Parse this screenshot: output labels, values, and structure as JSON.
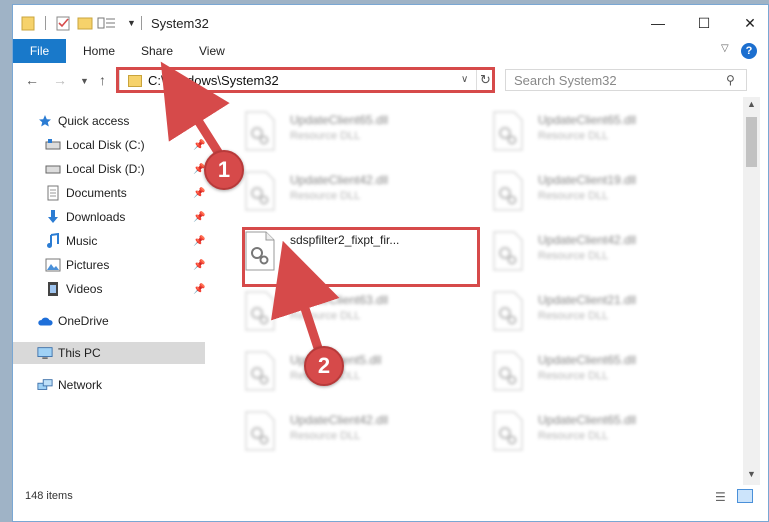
{
  "window": {
    "title": "System32",
    "controls": {
      "minimize": "—",
      "maximize": "☐",
      "close": "✕"
    }
  },
  "ribbon": {
    "tabs": [
      {
        "label": "File"
      },
      {
        "label": "Home"
      },
      {
        "label": "Share"
      },
      {
        "label": "View"
      }
    ],
    "help": "?"
  },
  "address": {
    "path": "C:\\Windows\\System32",
    "search_placeholder": "Search System32"
  },
  "sidebar": {
    "items": [
      {
        "label": "Quick access",
        "icon": "star-icon",
        "pinned": false
      },
      {
        "label": "Local Disk (C:)",
        "icon": "drive-icon",
        "pinned": true
      },
      {
        "label": "Local Disk (D:)",
        "icon": "drive-icon",
        "pinned": true
      },
      {
        "label": "Documents",
        "icon": "documents-icon",
        "pinned": true
      },
      {
        "label": "Downloads",
        "icon": "download-icon",
        "pinned": true
      },
      {
        "label": "Music",
        "icon": "music-icon",
        "pinned": true
      },
      {
        "label": "Pictures",
        "icon": "pictures-icon",
        "pinned": true
      },
      {
        "label": "Videos",
        "icon": "video-icon",
        "pinned": true
      },
      {
        "label": "OneDrive",
        "icon": "cloud-icon",
        "pinned": false
      },
      {
        "label": "This PC",
        "icon": "computer-icon",
        "pinned": false
      },
      {
        "label": "Network",
        "icon": "network-icon",
        "pinned": false
      }
    ]
  },
  "files": {
    "left": [
      {
        "name": "UpdateClient65.dll",
        "type": "Resource DLL"
      },
      {
        "name": "UpdateClient42.dll",
        "type": "Resource DLL"
      },
      {
        "name": "sdspfilter2_fixpt_fir...",
        "type": ""
      },
      {
        "name": "UpdateClient63.dll",
        "type": "Resource DLL"
      },
      {
        "name": "UpdateClient5.dll",
        "type": "Resource DLL"
      },
      {
        "name": "UpdateClient42.dll",
        "type": "Resource DLL"
      }
    ],
    "right": [
      {
        "name": "UpdateClient65.dll",
        "type": "Resource DLL"
      },
      {
        "name": "UpdateClient19.dll",
        "type": "Resource DLL"
      },
      {
        "name": "UpdateClient42.dll",
        "type": "Resource DLL"
      },
      {
        "name": "UpdateClient21.dll",
        "type": "Resource DLL"
      },
      {
        "name": "UpdateClient65.dll",
        "type": "Resource DLL"
      },
      {
        "name": "UpdateClient65.dll",
        "type": "Resource DLL"
      }
    ]
  },
  "status": {
    "item_count": "148 items"
  },
  "annotations": {
    "step1": "1",
    "step2": "2"
  },
  "colors": {
    "accent": "#1979ca",
    "highlight": "#d64a4a",
    "selection": "#cce8ff"
  }
}
